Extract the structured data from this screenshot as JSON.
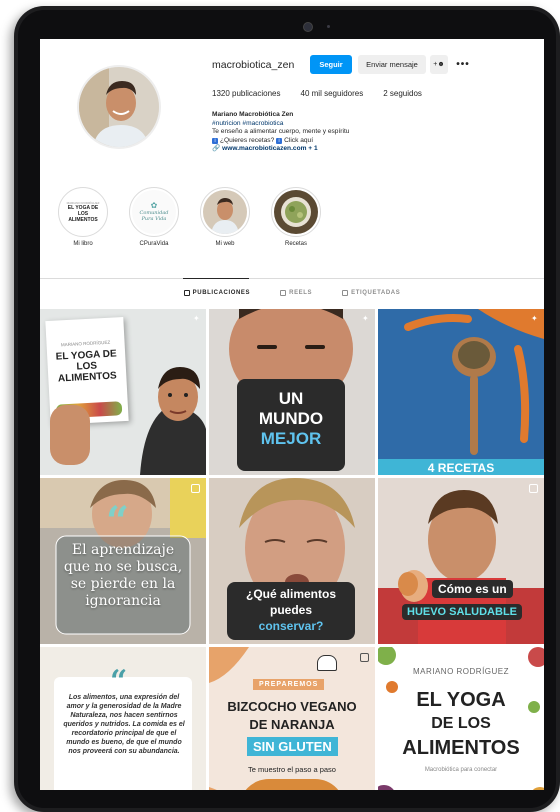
{
  "profile": {
    "username": "macrobiotica_zen",
    "follow_label": "Seguir",
    "message_label": "Enviar mensaje",
    "suggest_icon": "+person-icon",
    "more_icon": "•••",
    "stats": {
      "posts": "1320 publicaciones",
      "followers": "40 mil seguidores",
      "following": "2 seguidos"
    },
    "bio": {
      "name": "Mariano Macrobiótica Zen",
      "tags": "#nutricion #macrobiotica",
      "line1": "Te enseño a alimentar cuerpo, mente y espíritu",
      "line2a": "¿Quieres recetas?",
      "line2b": "Click aquí",
      "link": "www.macrobioticazen.com + 1"
    }
  },
  "highlights": [
    {
      "label": "Mi libro",
      "cover_text": "EL YOGA DE LOS ALIMENTOS",
      "cover_top": "MARIANO RODRÍGUEZ"
    },
    {
      "label": "CPuraVida",
      "cover_text": "Comunidad Pura Vida"
    },
    {
      "label": "Mi web"
    },
    {
      "label": "Recetas"
    }
  ],
  "tabs": [
    {
      "label": "PUBLICACIONES",
      "active": true
    },
    {
      "label": "REELS",
      "active": false
    },
    {
      "label": "ETIQUETADAS",
      "active": false
    }
  ],
  "posts": {
    "p1_book_author": "MARIANO RODRÍGUEZ",
    "p1_book_title": "EL YOGA DE LOS ALIMENTOS",
    "p2_line1": "UN",
    "p2_line2": "MUNDO",
    "p2_line3": "MEJOR",
    "p3_text": "4 RECETAS",
    "p4_quote": "El aprendizaje que no se busca, se pierde en la ignorancia",
    "p5_line1": "¿Qué alimentos",
    "p5_line2": "puedes",
    "p5_line3": "conservar?",
    "p6_line1": "Cómo es un",
    "p6_line2": "HUEVO SALUDABLE",
    "p7_quote": "Los alimentos, una expresión del amor y la generosidad de la Madre Naturaleza, nos hacen sentirnos queridos y nutridos. La comida es el recordatorio principal de que el mundo es bueno, de que el mundo nos proveerá con su abundancia.",
    "p8_pre": "PREPAREMOS",
    "p8_line1": "BIZCOCHO VEGANO",
    "p8_line2": "DE NARANJA",
    "p8_line3": "SIN GLUTEN",
    "p8_sub": "Te muestro el paso a paso",
    "p9_author": "MARIANO RODRÍGUEZ",
    "p9_line1": "EL YOGA",
    "p9_line2": "DE LOS",
    "p9_line3": "ALIMENTOS",
    "p9_sub": "Macrobiótica para conectar"
  },
  "colors": {
    "accent": "#0095f6",
    "link": "#00376b",
    "tile_dark": "#2b2b2b",
    "tile_blue": "#2f6ba8",
    "tile_cyan": "#3fb5d6"
  }
}
